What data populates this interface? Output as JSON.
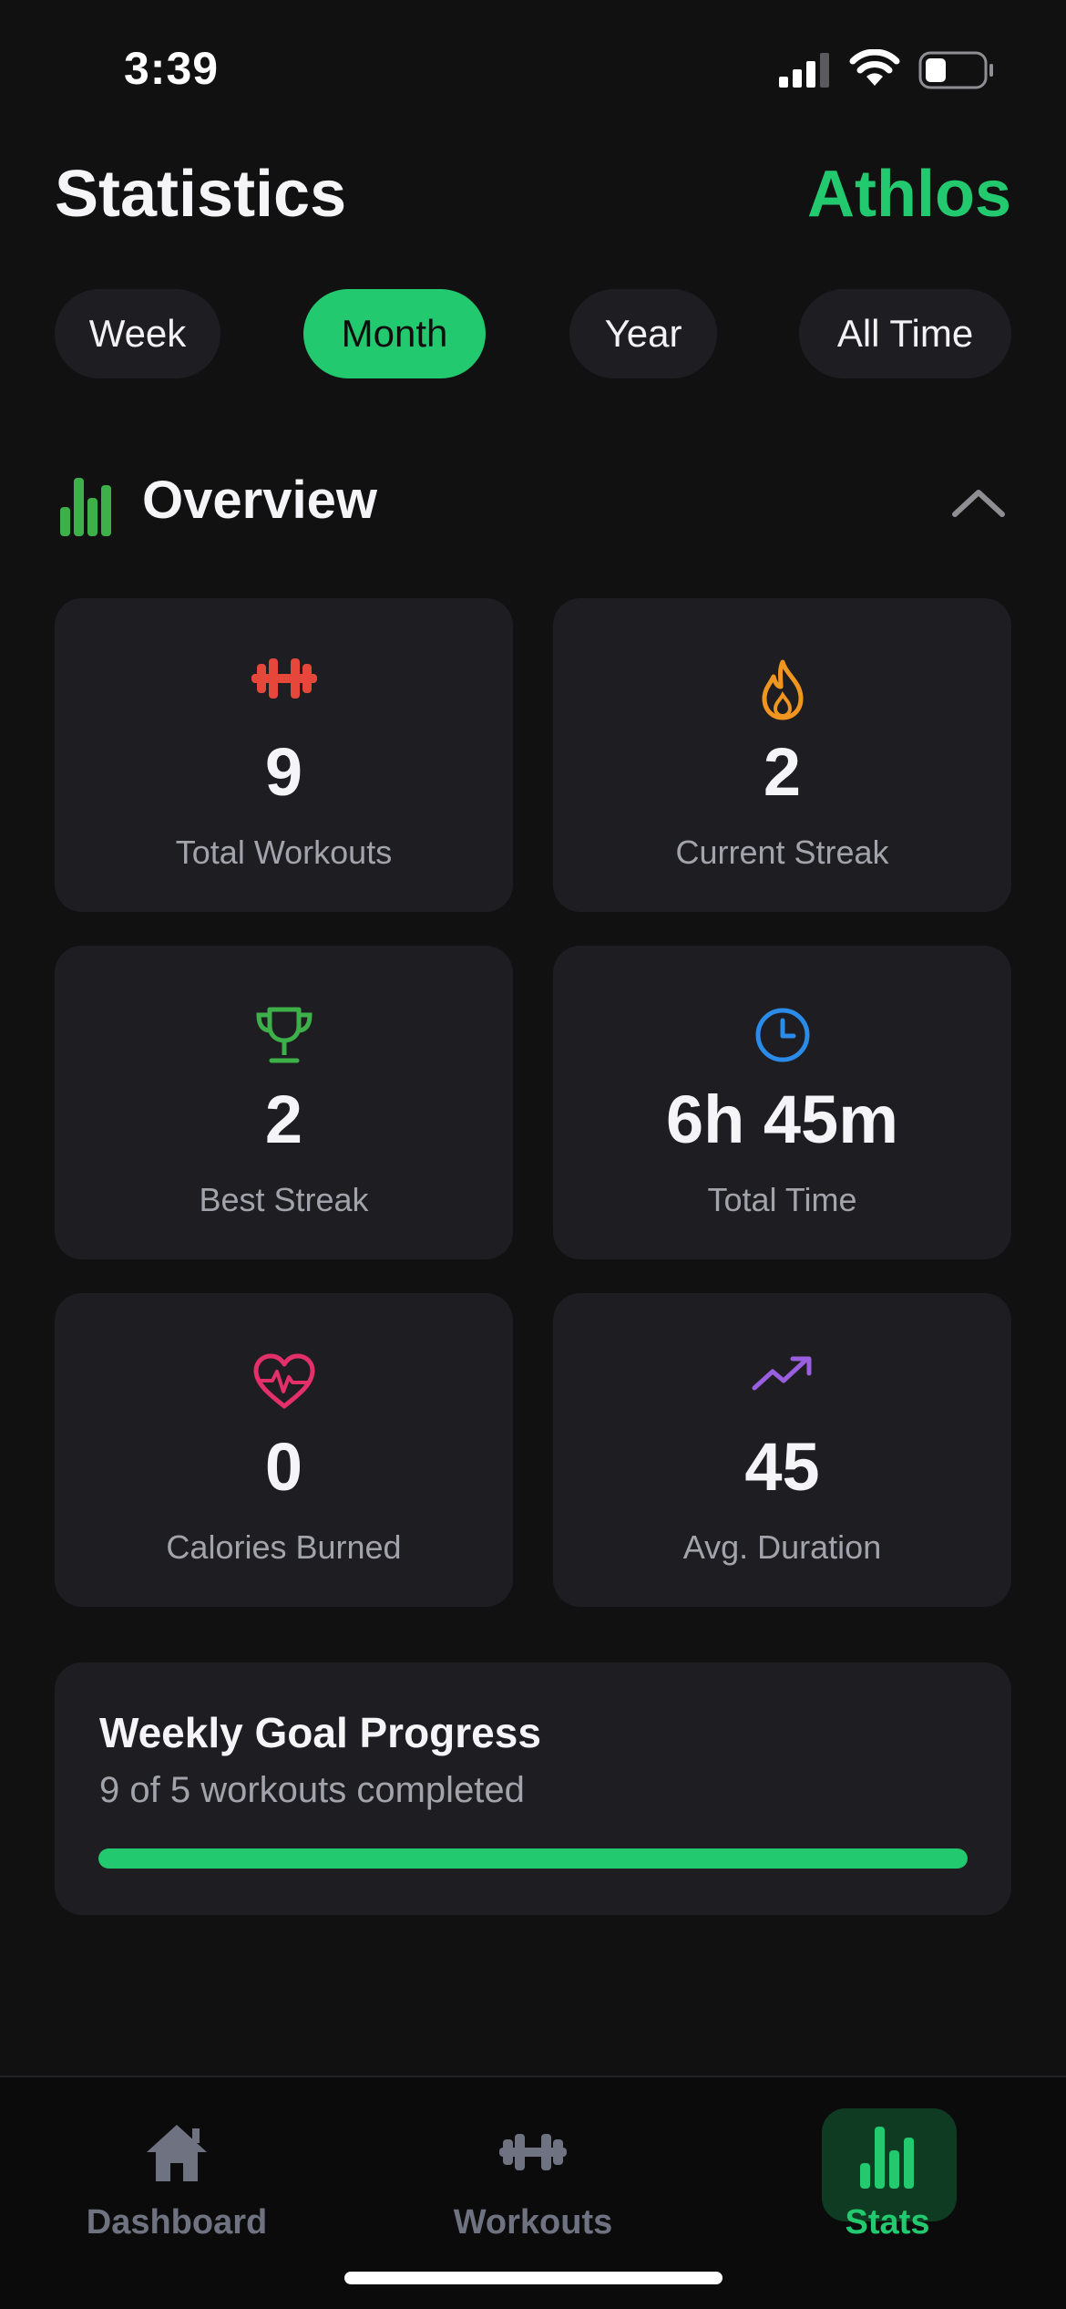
{
  "status_bar": {
    "time": "3:39"
  },
  "header": {
    "title": "Statistics",
    "brand": "Athlos"
  },
  "period_tabs": [
    {
      "label": "Week",
      "active": false
    },
    {
      "label": "Month",
      "active": true
    },
    {
      "label": "Year",
      "active": false
    },
    {
      "label": "All Time",
      "active": false
    }
  ],
  "overview": {
    "title": "Overview",
    "icon": "bar-chart-icon",
    "collapse_icon": "chevron-up-icon"
  },
  "stats": [
    {
      "value": "9",
      "label": "Total Workouts",
      "icon": "dumbbell-icon",
      "color": "#e5483b"
    },
    {
      "value": "2",
      "label": "Current Streak",
      "icon": "flame-icon",
      "color": "#f0951e"
    },
    {
      "value": "2",
      "label": "Best Streak",
      "icon": "trophy-icon",
      "color": "#3db04a"
    },
    {
      "value": "6h 45m",
      "label": "Total Time",
      "icon": "clock-icon",
      "color": "#2a8be8"
    },
    {
      "value": "0",
      "label": "Calories Burned",
      "icon": "heartbeat-icon",
      "color": "#e32f6a"
    },
    {
      "value": "45",
      "label": "Avg. Duration",
      "icon": "trending-up-icon",
      "color": "#9a5fe0"
    }
  ],
  "weekly_goal": {
    "title": "Weekly Goal Progress",
    "subtitle": "9 of 5 workouts completed",
    "progress": 1.0
  },
  "bottom_nav": [
    {
      "label": "Dashboard",
      "icon": "home-icon",
      "active": false
    },
    {
      "label": "Workouts",
      "icon": "dumbbell-icon",
      "active": false
    },
    {
      "label": "Stats",
      "icon": "bar-chart-icon",
      "active": true
    }
  ],
  "colors": {
    "accent": "#22c96e",
    "background": "#111112",
    "card": "#1e1e22"
  }
}
